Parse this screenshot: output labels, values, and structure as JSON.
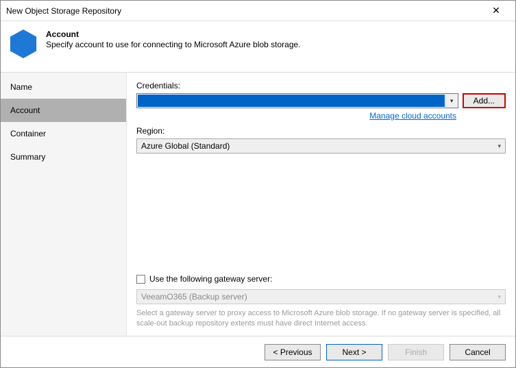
{
  "window": {
    "title": "New Object Storage Repository"
  },
  "header": {
    "title": "Account",
    "subtitle": "Specify account to use for connecting to Microsoft Azure blob storage."
  },
  "sidebar": {
    "items": [
      {
        "label": "Name"
      },
      {
        "label": "Account"
      },
      {
        "label": "Container"
      },
      {
        "label": "Summary"
      }
    ]
  },
  "form": {
    "credentials_label": "Credentials:",
    "credentials_value": "",
    "add_label": "Add...",
    "manage_link": "Manage cloud accounts",
    "region_label": "Region:",
    "region_value": "Azure Global (Standard)",
    "gateway_checkbox_label": "Use the following gateway server:",
    "gateway_value": "VeeamO365 (Backup server)",
    "gateway_hint": "Select a gateway server to proxy access to Microsoft Azure blob storage. If no gateway server is specified, all scale-out backup repository extents must have direct Internet access."
  },
  "footer": {
    "previous": "< Previous",
    "next": "Next >",
    "finish": "Finish",
    "cancel": "Cancel"
  }
}
